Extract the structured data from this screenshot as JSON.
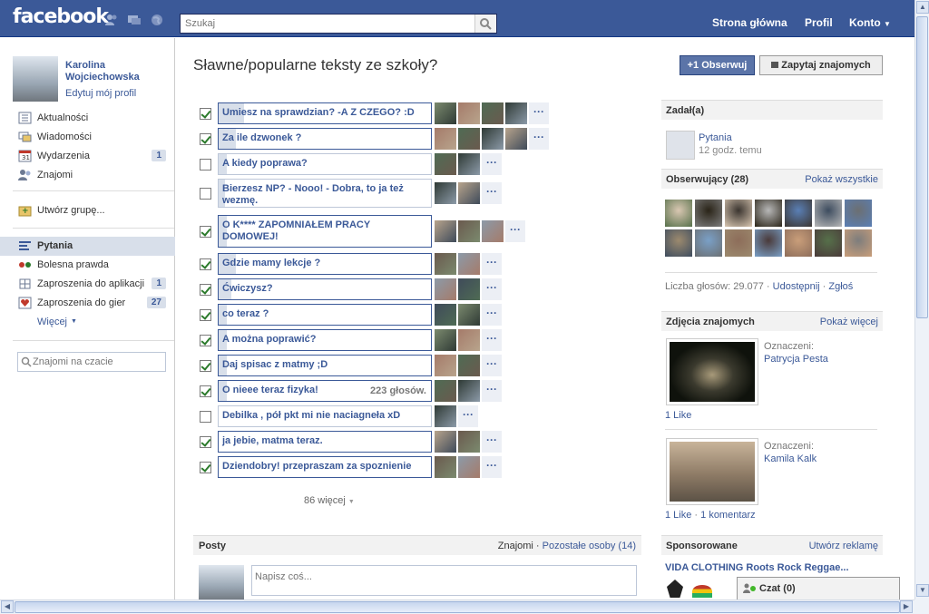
{
  "topbar": {
    "logo": "facebook",
    "search_placeholder": "Szukaj",
    "nav": [
      "Strona główna",
      "Profil",
      "Konto"
    ]
  },
  "profile": {
    "name": "Karolina Wojciechowska",
    "edit": "Edytuj mój profil"
  },
  "nav": [
    {
      "label": "Aktualności",
      "icon": "news-feed-icon",
      "count": ""
    },
    {
      "label": "Wiadomości",
      "icon": "messages-icon",
      "count": ""
    },
    {
      "label": "Wydarzenia",
      "icon": "calendar-icon",
      "count": "1"
    },
    {
      "label": "Znajomi",
      "icon": "friends-icon",
      "count": ""
    },
    {
      "label": "Utwórz grupę...",
      "icon": "group-icon",
      "count": ""
    },
    {
      "label": "Pytania",
      "icon": "questions-icon",
      "count": ""
    },
    {
      "label": "Bolesna prawda",
      "icon": "app-icon",
      "count": ""
    },
    {
      "label": "Zaproszenia do aplikacji",
      "icon": "puzzle-icon",
      "count": "1"
    },
    {
      "label": "Zaproszenia do gier",
      "icon": "game-icon",
      "count": "27"
    },
    {
      "label": "Więcej",
      "icon": "",
      "count": ""
    }
  ],
  "chat_search_placeholder": "Znajomi na czacie",
  "question": {
    "title": "Sławne/popularne teksty ze szkoły?",
    "follow": "Obserwuj",
    "ask": "Zapytaj znajomych",
    "follow_glyph": "+1",
    "more_glyph": "···",
    "options": [
      {
        "text": "Umiesz na sprawdzian? -A Z CZEGO? :D",
        "checked": true,
        "fill": 0.12,
        "faces": 4,
        "more": true
      },
      {
        "text": "Za ile dzwonek ?",
        "checked": true,
        "fill": 0.08,
        "faces": 4,
        "more": true
      },
      {
        "text": "A kiedy poprawa?",
        "checked": false,
        "fill": 0.04,
        "faces": 2,
        "more": true
      },
      {
        "text": "Bierzesz NP? - Nooo! - Dobra, to ja też wezmę.",
        "checked": false,
        "fill": 0.03,
        "faces": 2,
        "more": true
      },
      {
        "text": "O K**** ZAPOMNIAŁEM PRACY DOMOWEJ!",
        "checked": true,
        "fill": 0.04,
        "faces": 3,
        "more": true
      },
      {
        "text": "Gdzie mamy lekcje ?",
        "checked": true,
        "fill": 0.08,
        "faces": 2,
        "more": true
      },
      {
        "text": "Ćwiczysz?",
        "checked": true,
        "fill": 0.06,
        "faces": 2,
        "more": true
      },
      {
        "text": "co teraz ?",
        "checked": true,
        "fill": 0.04,
        "faces": 2,
        "more": true
      },
      {
        "text": "A można poprawić?",
        "checked": true,
        "fill": 0.04,
        "faces": 2,
        "more": true
      },
      {
        "text": "Daj spisac z matmy ;D",
        "checked": true,
        "fill": 0.04,
        "faces": 2,
        "more": true
      },
      {
        "text": "O nieee teraz fizyka!",
        "checked": true,
        "fill": 0.04,
        "faces": 2,
        "more": true,
        "votes": "223 głosów."
      },
      {
        "text": "Debilka , pół pkt mi nie naciagneła xD",
        "checked": false,
        "fill": 0.0,
        "faces": 1,
        "more": true
      },
      {
        "text": "ja jebie, matma teraz.",
        "checked": true,
        "fill": 0.0,
        "faces": 2,
        "more": true
      },
      {
        "text": "Dziendobry! przepraszam za spoznienie",
        "checked": true,
        "fill": 0.0,
        "faces": 2,
        "more": true
      }
    ],
    "more_link": "86 więcej"
  },
  "posty": {
    "title": "Posty",
    "filter1": "Znajomi",
    "filter2": "Pozostałe osoby (14)",
    "placeholder": "Napisz coś..."
  },
  "right": {
    "asked_header": "Zadał(a)",
    "asked_app": "Pytania",
    "asked_time": "12 godz. temu",
    "followers_header": "Obserwujący (28)",
    "followers_link": "Pokaż wszystkie",
    "stats": "Liczba głosów: 29.077",
    "share": "Udostępnij",
    "report": "Zgłoś",
    "photos_header": "Zdjęcia znajomych",
    "photos_link": "Pokaż więcej",
    "photo1_tag_label": "Oznaczeni:",
    "photo1_tag": "Patrycja Pesta",
    "photo1_likes": "1 Like",
    "photo2_tag_label": "Oznaczeni:",
    "photo2_tag": "Kamila Kalk",
    "photo2_likes": "1 Like",
    "photo2_comments": "1 komentarz",
    "sponsored_header": "Sponsorowane",
    "sponsored_link": "Utwórz reklamę",
    "ad_title": "VIDA CLOTHING Roots Rock Reggae..."
  },
  "chat": {
    "label": "Czat (0)"
  }
}
